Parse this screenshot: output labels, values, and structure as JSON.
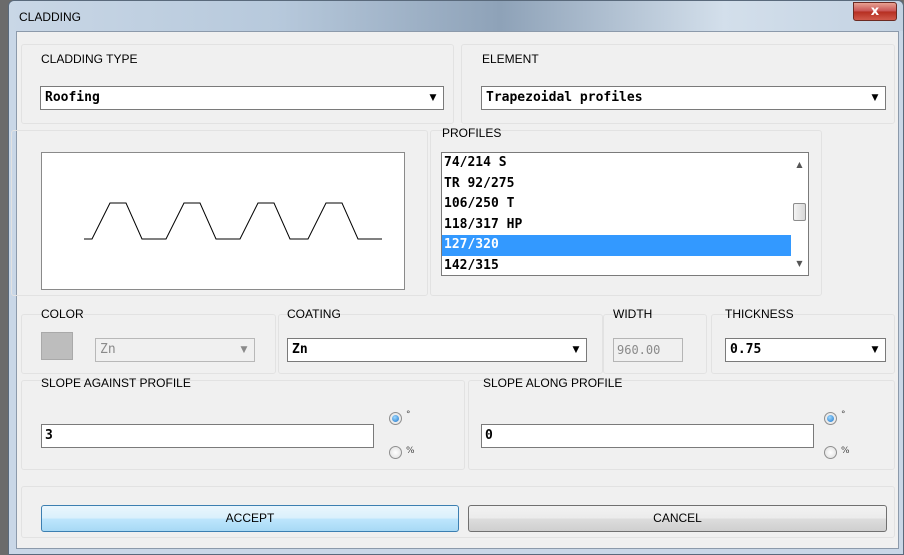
{
  "window": {
    "title": "CLADDING",
    "close_glyph": "x"
  },
  "cladding_type": {
    "label": "CLADDING TYPE",
    "value": "Roofing"
  },
  "element": {
    "label": "ELEMENT",
    "value": "Trapezoidal profiles"
  },
  "profiles": {
    "label": "PROFILES",
    "items": [
      "74/214 S",
      "TR 92/275",
      "106/250 T",
      "118/317 HP",
      "127/320",
      "142/315"
    ],
    "selected": "127/320"
  },
  "color": {
    "label": "COLOR",
    "value": "Zn",
    "swatch": "#bdbdbd"
  },
  "coating": {
    "label": "COATING",
    "value": "Zn"
  },
  "width": {
    "label": "WIDTH",
    "value": "960.00"
  },
  "thickness": {
    "label": "THICKNESS",
    "value": "0.75"
  },
  "slope_against": {
    "label": "SLOPE AGAINST PROFILE",
    "value": "3",
    "unit_degree": "°",
    "unit_percent": "%",
    "selected_unit": "°"
  },
  "slope_along": {
    "label": "SLOPE ALONG PROFILE",
    "value": "0",
    "unit_degree": "°",
    "unit_percent": "%",
    "selected_unit": "°"
  },
  "buttons": {
    "accept": "ACCEPT",
    "cancel": "CANCEL"
  },
  "icons": {
    "dropdown": "chevron-down-icon",
    "scroll_up": "scroll-up-arrow-icon",
    "scroll_down": "scroll-down-arrow-icon",
    "close": "close-icon"
  }
}
